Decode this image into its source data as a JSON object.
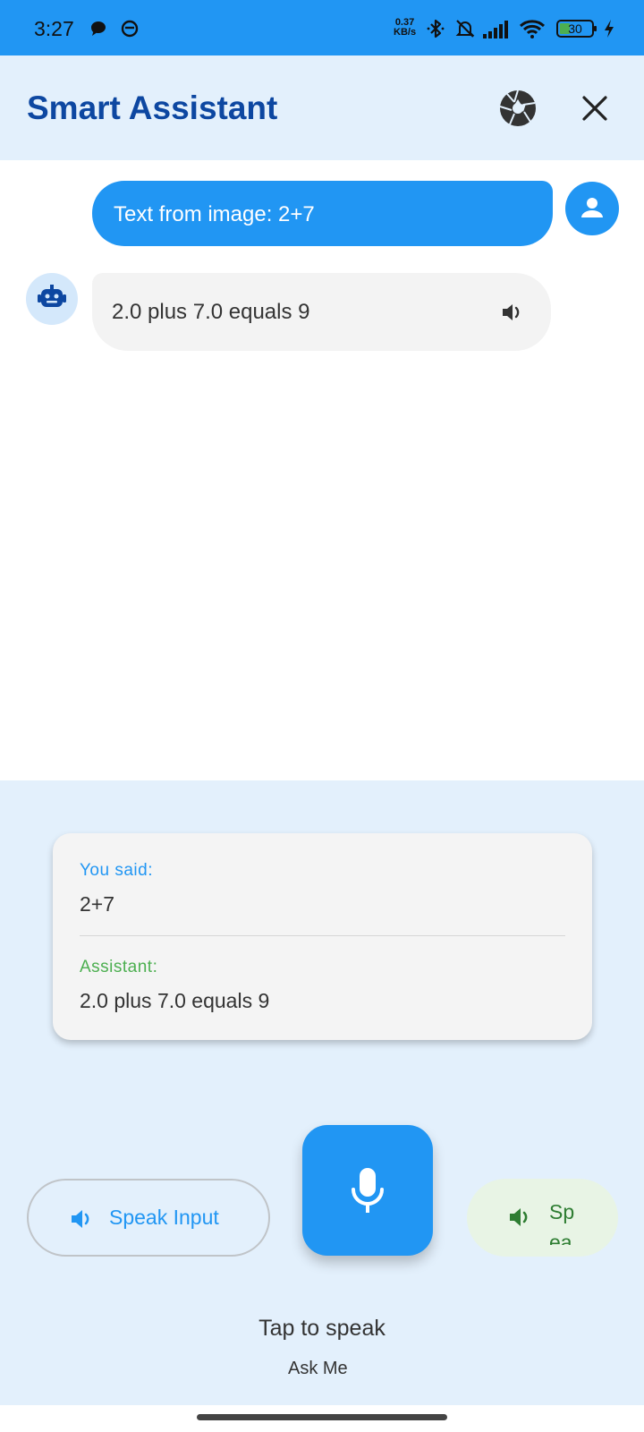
{
  "status_bar": {
    "time": "3:27",
    "net_speed_value": "0.37",
    "net_speed_unit": "KB/s",
    "battery": "30",
    "color": "#2196F3"
  },
  "header": {
    "title": "Smart Assistant",
    "camera_icon": "camera-shutter-icon",
    "close_icon": "close-icon"
  },
  "chat": {
    "messages": [
      {
        "sender": "user",
        "text": "Text from image: 2+7"
      },
      {
        "sender": "assistant",
        "text": "2.0 plus 7.0 equals 9"
      }
    ]
  },
  "summary": {
    "you_said_label": "You said:",
    "you_said_text": "2+7",
    "assistant_label": "Assistant:",
    "assistant_text": "2.0 plus 7.0 equals 9"
  },
  "controls": {
    "speak_input_label": "Speak Input",
    "speak_output_label": "Speak Output",
    "mic_icon": "microphone-icon",
    "tap_to_speak": "Tap to speak",
    "ask_me": "Ask Me"
  },
  "colors": {
    "primary": "#2196F3",
    "title": "#0D47A1",
    "panel_bg": "#E3F0FC",
    "assistant_label": "#4CAF50",
    "speak_output_text": "#2E7D32"
  }
}
